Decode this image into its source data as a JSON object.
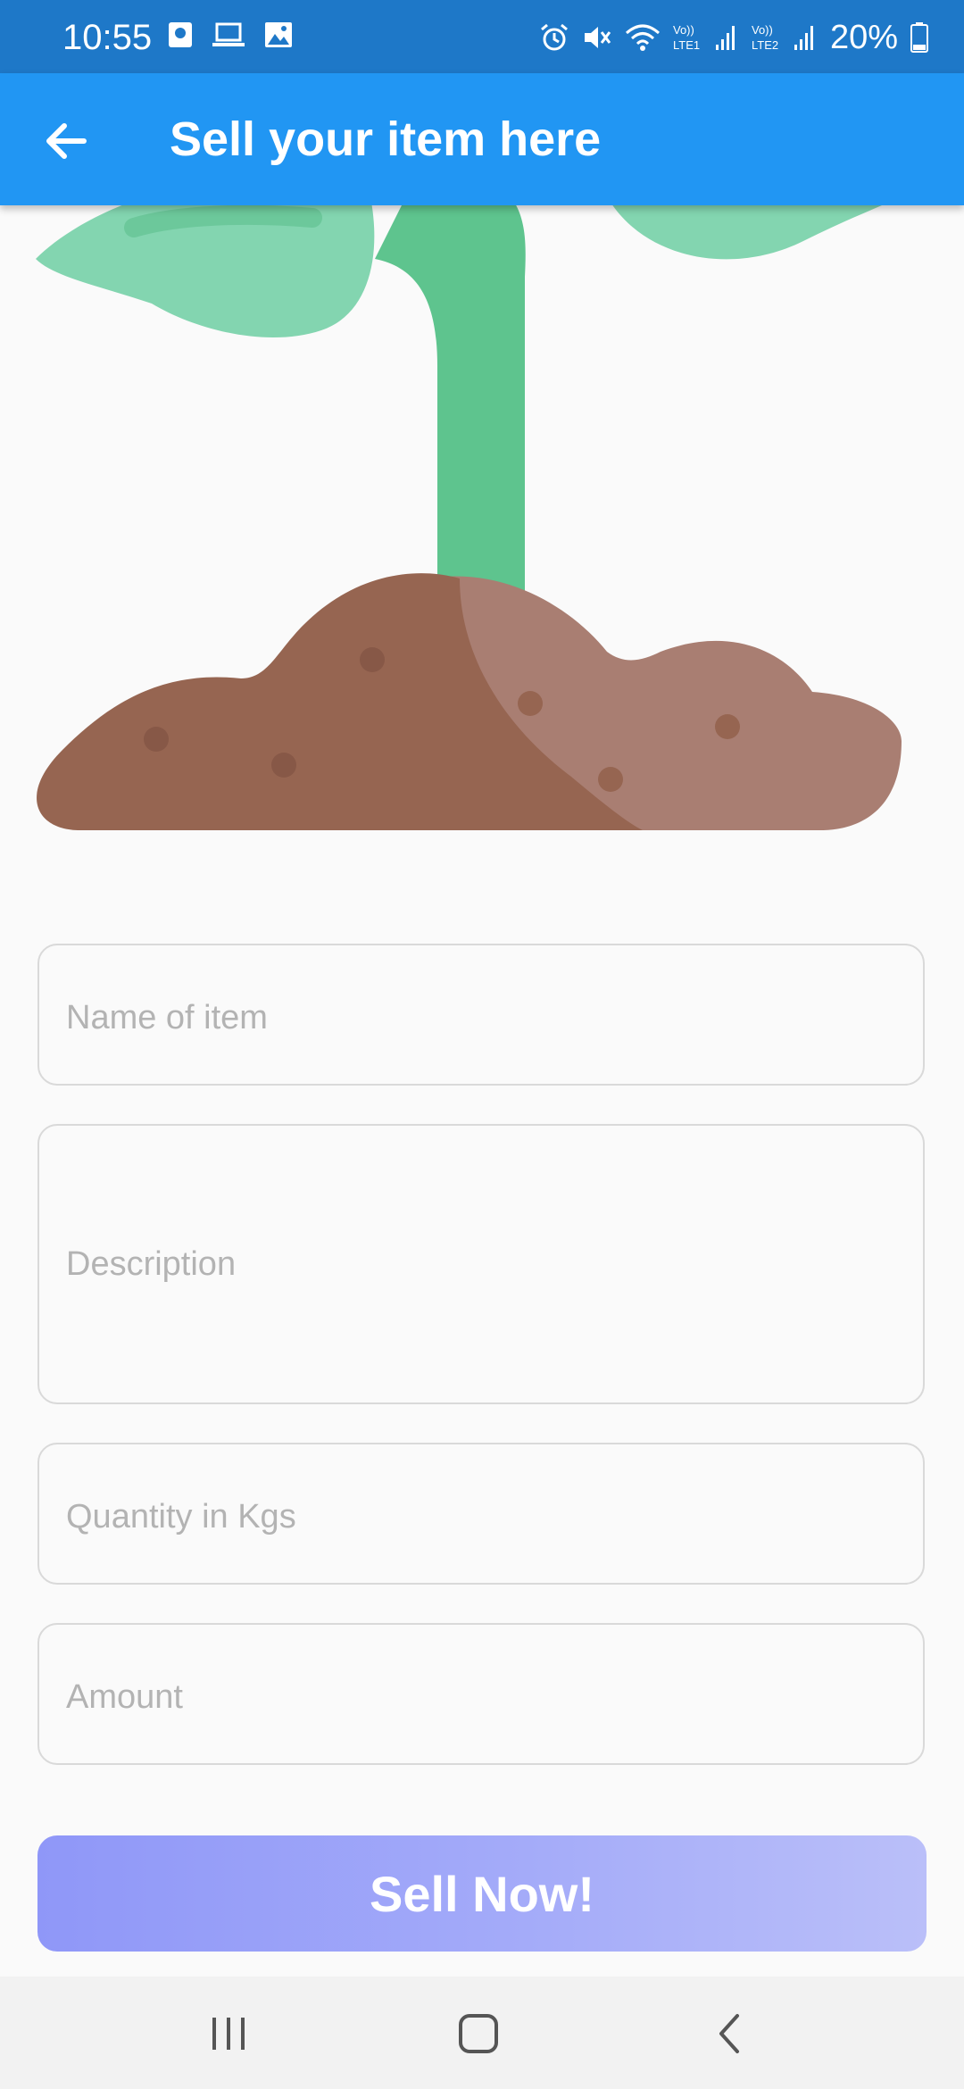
{
  "status_bar": {
    "time": "10:55",
    "battery": "20%",
    "icons": [
      "notification-icon",
      "laptop-icon",
      "image-icon",
      "alarm-icon",
      "mute-icon",
      "wifi-icon",
      "signal-lte1-icon",
      "signal-lte2-icon",
      "battery-icon"
    ]
  },
  "app_bar": {
    "title": "Sell your item here",
    "back_icon": "arrow-back-icon",
    "color": "#2196f3"
  },
  "hero_image": {
    "subject": "plant sprout in soil",
    "colors": {
      "leaf": "#83d5b0",
      "stem": "#5ec48e",
      "soil": "#966551",
      "soil_light": "#a97e72"
    }
  },
  "form": {
    "name_placeholder": "Name of item",
    "description_placeholder": "Description",
    "quantity_placeholder": "Quantity in Kgs",
    "amount_placeholder": "Amount",
    "submit_label": "Sell Now!"
  },
  "nav_bar": {
    "items": [
      "recents-icon",
      "home-icon",
      "back-icon"
    ]
  }
}
